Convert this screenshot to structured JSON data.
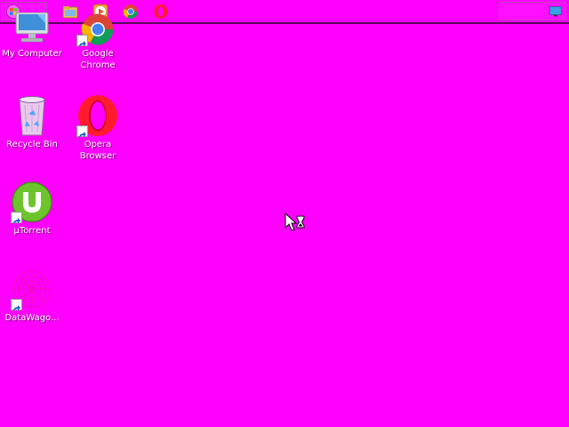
{
  "colors": {
    "desktop_background": "#ff00ff",
    "taskbar_border": "#5a0a5a"
  },
  "taskbar": {
    "start_icon": "windows-orb-icon",
    "pinned": [
      {
        "name": "file-explorer-icon"
      },
      {
        "name": "media-player-icon"
      },
      {
        "name": "chrome-icon"
      },
      {
        "name": "opera-icon"
      }
    ],
    "tray_icon": "show-desktop-icon"
  },
  "desktop": {
    "icons": [
      {
        "label": "My Computer",
        "icon": "computer-icon",
        "shortcut": false
      },
      {
        "label": "Google\nChrome",
        "icon": "chrome-icon",
        "shortcut": true
      },
      {
        "label": "Recycle Bin",
        "icon": "recycle-bin-icon",
        "shortcut": false
      },
      {
        "label": "Opera\nBrowser",
        "icon": "opera-icon",
        "shortcut": true
      },
      {
        "label": "µTorrent",
        "icon": "utorrent-icon",
        "shortcut": true
      },
      {
        "label": "DataWago...",
        "icon": "datawagon-icon",
        "shortcut": true
      }
    ]
  },
  "cursor": {
    "state": "busy",
    "icon": "busy-cursor-icon"
  }
}
